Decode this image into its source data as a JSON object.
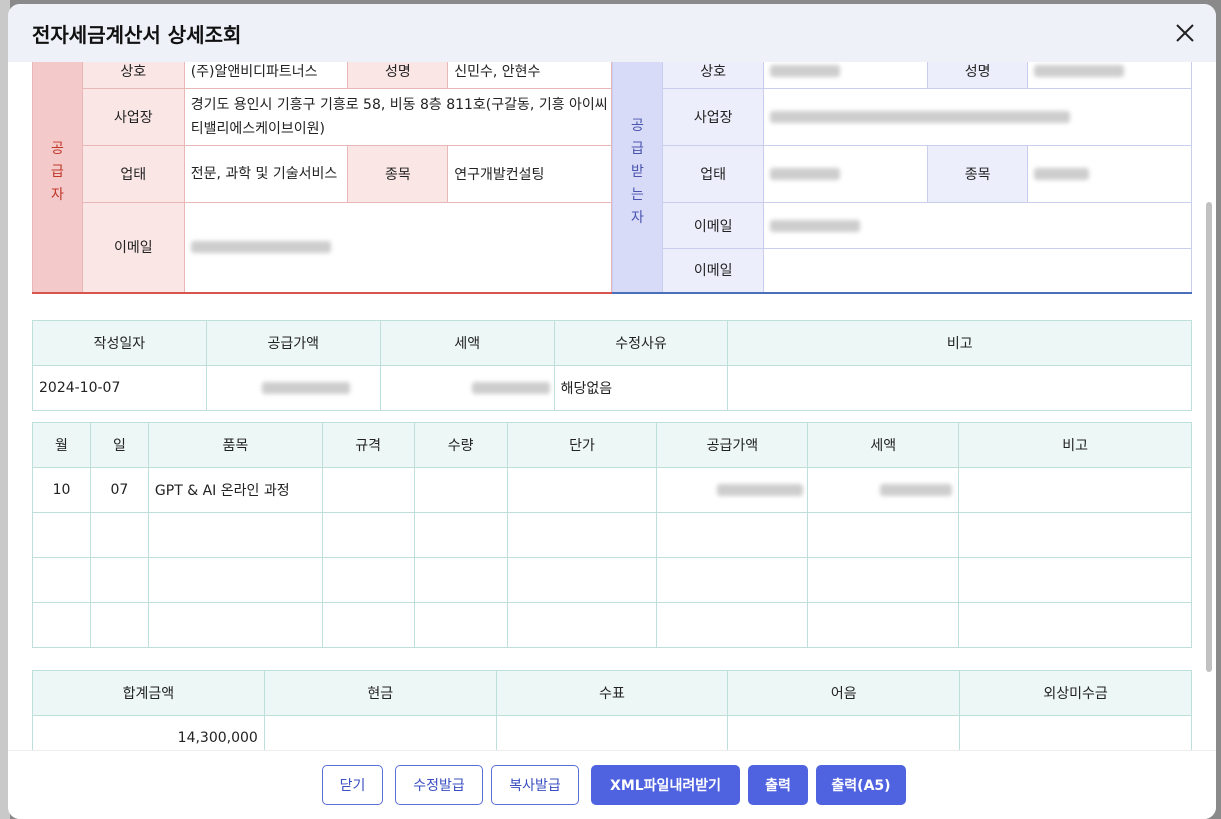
{
  "modal": {
    "title": "전자세금계산서 상세조회"
  },
  "supplier": {
    "side_chars": [
      "공",
      "급",
      "자"
    ],
    "labels": {
      "company": "상호",
      "name": "성명",
      "address": "사업장",
      "business_type": "업태",
      "item": "종목",
      "email": "이메일"
    },
    "company": "(주)알앤비디파트너스",
    "name": "신민수, 안현수",
    "address": "경기도 용인시 기흥구 기흥로 58, 비동 8층 811호(구갈동, 기흥 아이씨티밸리에스케이브이원)",
    "business_type": "전문, 과학 및 기술서비스",
    "item": "연구개발컨설팅"
  },
  "receiver": {
    "side_chars": [
      "공",
      "급",
      "받",
      "는",
      "자"
    ],
    "labels": {
      "company": "상호",
      "name": "성명",
      "address": "사업장",
      "business_type": "업태",
      "item": "종목",
      "email": "이메일",
      "email2": "이메일"
    }
  },
  "summary": {
    "headers": [
      "작성일자",
      "공급가액",
      "세액",
      "수정사유",
      "비고"
    ],
    "date": "2024-10-07",
    "reason": "해당없음"
  },
  "items": {
    "headers": [
      "월",
      "일",
      "품목",
      "규격",
      "수량",
      "단가",
      "공급가액",
      "세액",
      "비고"
    ],
    "rows": [
      {
        "month": "10",
        "day": "07",
        "name": "GPT & AI 온라인 과정"
      }
    ]
  },
  "totals": {
    "headers": [
      "합계금액",
      "현금",
      "수표",
      "어음",
      "외상미수금"
    ],
    "total": "14,300,000"
  },
  "footer": {
    "close": "닫기",
    "amend": "수정발급",
    "copy": "복사발급",
    "xml": "XML파일내려받기",
    "print": "출력",
    "print_a5": "출력(A5)"
  },
  "colors": {
    "accent": "#4f63e0",
    "supplier": "#f4c9c9",
    "receiver": "#d7dbf7",
    "grid_header": "#edf7f5"
  }
}
